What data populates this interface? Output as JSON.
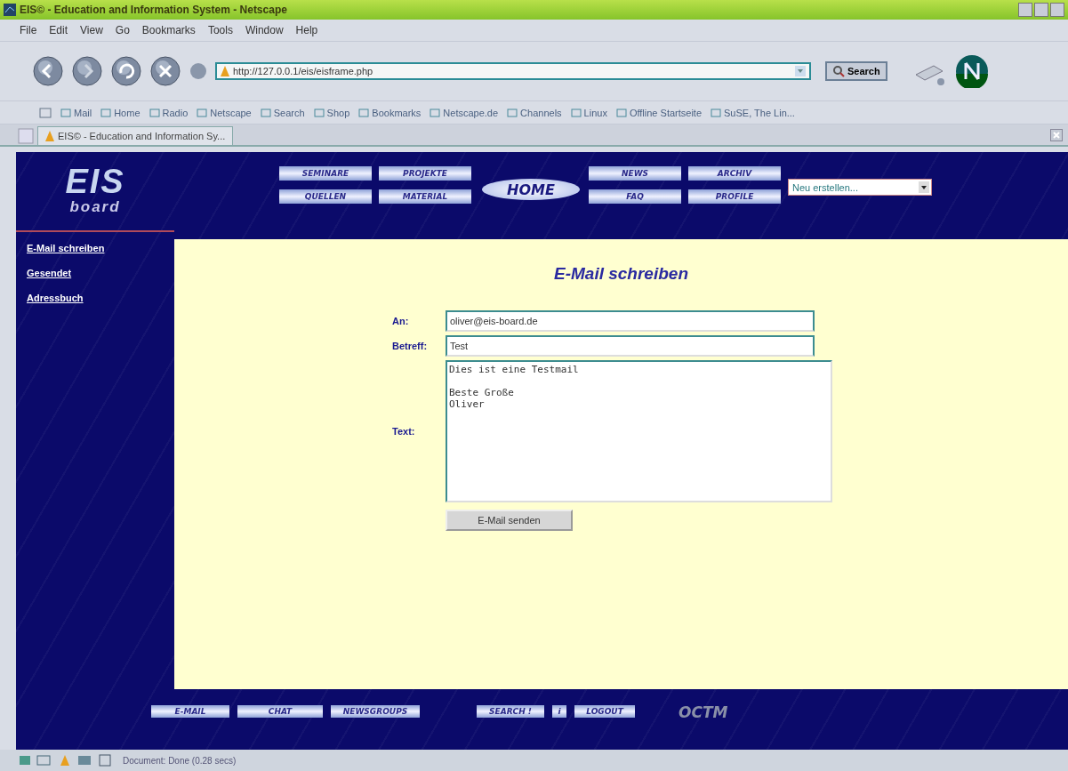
{
  "window": {
    "title": "EIS© - Education and Information System - Netscape"
  },
  "menu": [
    "File",
    "Edit",
    "View",
    "Go",
    "Bookmarks",
    "Tools",
    "Window",
    "Help"
  ],
  "toolbar": {
    "url": "http://127.0.0.1/eis/eisframe.php",
    "search_button": "Search"
  },
  "bookmarks": [
    "Mail",
    "Home",
    "Radio",
    "Netscape",
    "Search",
    "Shop",
    "Bookmarks",
    "Netscape.de",
    "Channels",
    "Linux",
    "Offline Startseite",
    "SuSE, The Lin..."
  ],
  "tab": {
    "label": "EIS© - Education and Information Sy..."
  },
  "page": {
    "logo": {
      "title": "EIS",
      "subtitle": "board"
    },
    "nav_left": [
      "SEMINARE",
      "PROJEKTE",
      "QUELLEN",
      "MATERIAL"
    ],
    "home": "HOME",
    "nav_right": [
      "NEWS",
      "ARCHIV",
      "FAQ",
      "PROFILE"
    ],
    "dropdown": "Neu erstellen...",
    "sidebar": [
      "E-Mail schreiben",
      "Gesendet",
      "Adressbuch"
    ],
    "heading": "E-Mail schreiben",
    "form": {
      "to_label": "An:",
      "to": "oliver@eis-board.de",
      "subject_label": "Betreff:",
      "subject": "Test",
      "text_label": "Text:",
      "text": "Dies ist eine Testmail\n\nBeste Große\nOliver",
      "submit": "E-Mail senden"
    },
    "footer": [
      "E-MAIL",
      "CHAT",
      "NEWSGROUPS",
      "SEARCH !",
      "i",
      "LOGOUT"
    ],
    "footer_logo": "OCTM"
  },
  "status": "Document: Done (0.28 secs)"
}
